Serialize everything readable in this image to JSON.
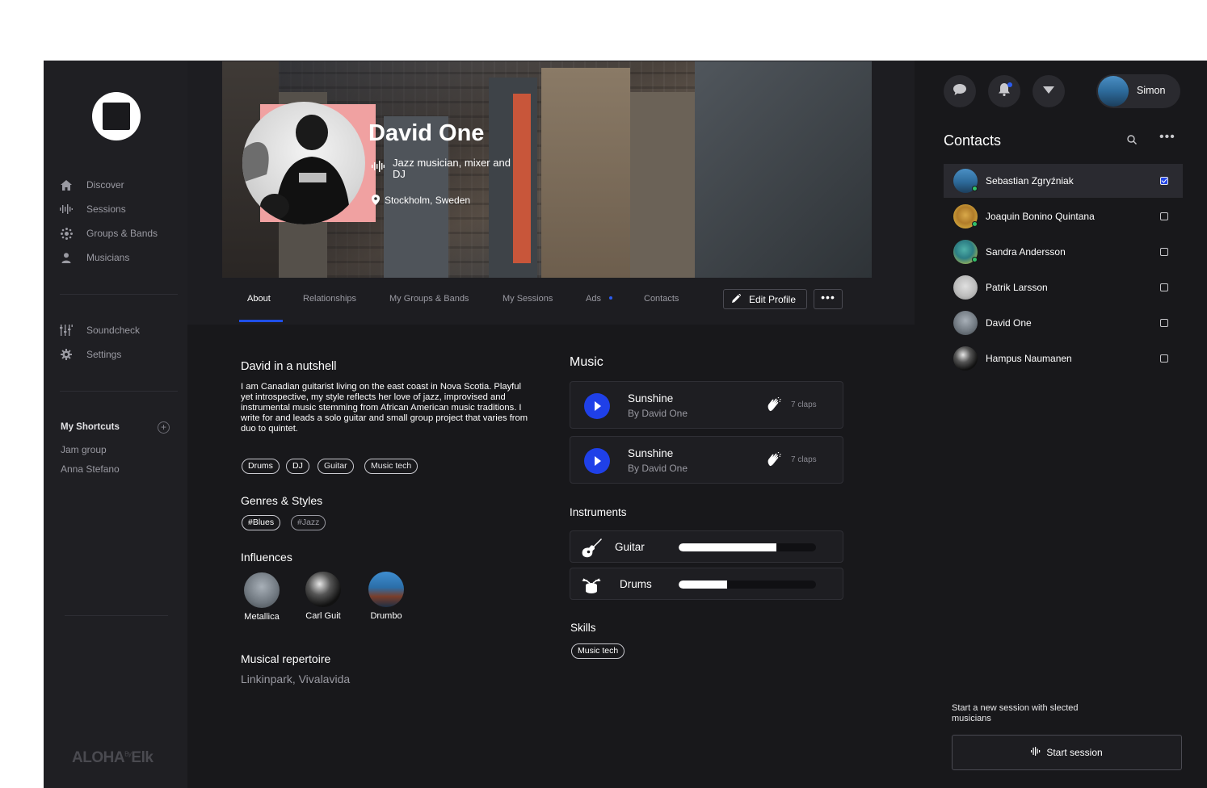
{
  "sidebar": {
    "nav": [
      {
        "label": "Discover",
        "icon": "home-icon"
      },
      {
        "label": "Sessions",
        "icon": "waveform-icon"
      },
      {
        "label": "Groups & Bands",
        "icon": "groups-icon"
      },
      {
        "label": "Musicians",
        "icon": "person-icon"
      }
    ],
    "nav2": [
      {
        "label": "Soundcheck",
        "icon": "sliders-icon"
      },
      {
        "label": "Settings",
        "icon": "gear-icon"
      }
    ],
    "shortcuts_title": "My Shortcuts",
    "shortcuts": [
      "Jam group",
      "Anna Stefano"
    ],
    "brand": "ALOHA",
    "brand_sup": "By",
    "brand_suffix": "Elk"
  },
  "profile": {
    "name": "David One",
    "role": "Jazz musician, mixer and DJ",
    "location": "Stockholm, Sweden"
  },
  "tabs": [
    "About",
    "Relationships",
    "My Groups & Bands",
    "My Sessions",
    "Ads",
    "Contacts"
  ],
  "active_tab": "About",
  "actions": {
    "edit_profile": "Edit Profile",
    "more": "•••"
  },
  "about": {
    "nutshell_title": "David in a nutshell",
    "bio": "I am  Canadian guitarist living on the east coast in Nova Scotia. Playful yet introspective, my style reflects her love of jazz, improvised and instrumental music stemming from African American music traditions. I write  for and leads a solo guitar and small group project that varies from duo to quintet.",
    "tags": [
      "Drums",
      "DJ",
      "Guitar",
      "Music tech"
    ],
    "genres_title": "Genres & Styles",
    "genres": [
      "#Blues",
      "#Jazz"
    ],
    "influences_title": "Influences",
    "influences": [
      "Metallica",
      "Carl Guit",
      "Drumbo"
    ],
    "repertoire_title": "Musical repertoire",
    "repertoire": "Linkinpark, Vivalavida"
  },
  "music": {
    "title": "Music",
    "tracks": [
      {
        "title": "Sunshine",
        "by": "By David One",
        "claps": "7 claps"
      },
      {
        "title": "Sunshine",
        "by": "By David One",
        "claps": "7 claps"
      }
    ]
  },
  "instruments": {
    "title": "Instruments",
    "items": [
      {
        "name": "Guitar",
        "level": 0.71
      },
      {
        "name": "Drums",
        "level": 0.35
      }
    ]
  },
  "skills": {
    "title": "Skills",
    "items": [
      "Music tech"
    ]
  },
  "header": {
    "user_name": "Simon"
  },
  "contacts": {
    "title": "Contacts",
    "items": [
      {
        "name": "Sebastian Zgryźniak",
        "checked": true,
        "online": true
      },
      {
        "name": "Joaquin Bonino Quintana",
        "checked": false,
        "online": true
      },
      {
        "name": "Sandra Andersson",
        "checked": false,
        "online": true
      },
      {
        "name": "Patrik Larsson",
        "checked": false,
        "online": false
      },
      {
        "name": "David One",
        "checked": false,
        "online": false
      },
      {
        "name": "Hampus Naumanen",
        "checked": false,
        "online": false
      }
    ],
    "start_hint": "Start a new session with slected musicians",
    "start_button": "Start session"
  },
  "colors": {
    "accent": "#1f40e8",
    "background": "#18181b",
    "sidebar": "#1f1f23",
    "online": "#31c26a"
  }
}
